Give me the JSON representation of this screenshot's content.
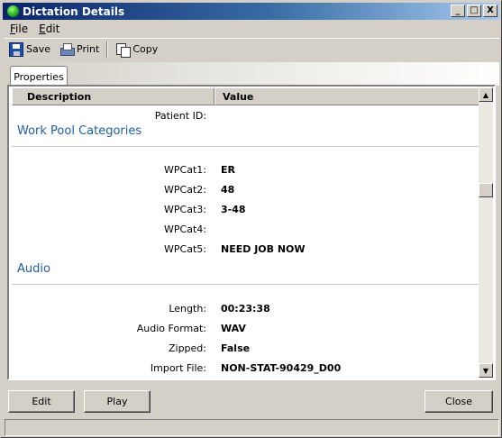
{
  "window": {
    "title": "Dictation Details",
    "controls": {
      "minimize": "_",
      "maximize": "□",
      "close": "X"
    }
  },
  "menu": {
    "file": {
      "hotkey": "F",
      "rest": "ile"
    },
    "edit": {
      "hotkey": "E",
      "rest": "dit"
    }
  },
  "toolbar": {
    "save_label": "Save",
    "print_label": "Print",
    "copy_label": "Copy"
  },
  "tabs": {
    "properties": "Properties"
  },
  "grid": {
    "col_description": "Description",
    "col_value": "Value",
    "patient_id_label": "Patient ID:",
    "patient_id_value": "",
    "section_work_pool": "Work Pool Categories",
    "wpcat": [
      {
        "label": "WPCat1:",
        "value": "ER"
      },
      {
        "label": "WPCat2:",
        "value": "48"
      },
      {
        "label": "WPCat3:",
        "value": "3-48"
      },
      {
        "label": "WPCat4:",
        "value": ""
      },
      {
        "label": "WPCat5:",
        "value": "NEED JOB NOW"
      }
    ],
    "section_audio": "Audio",
    "audio": [
      {
        "label": "Length:",
        "value": "00:23:38"
      },
      {
        "label": "Audio Format:",
        "value": "WAV"
      },
      {
        "label": "Zipped:",
        "value": "False"
      },
      {
        "label": "Import File:",
        "value": "NON-STAT-90429_D00"
      }
    ]
  },
  "buttons": {
    "edit": "Edit",
    "play": "Play",
    "close": "Close"
  },
  "scroll": {
    "position_fraction": 0.33
  }
}
